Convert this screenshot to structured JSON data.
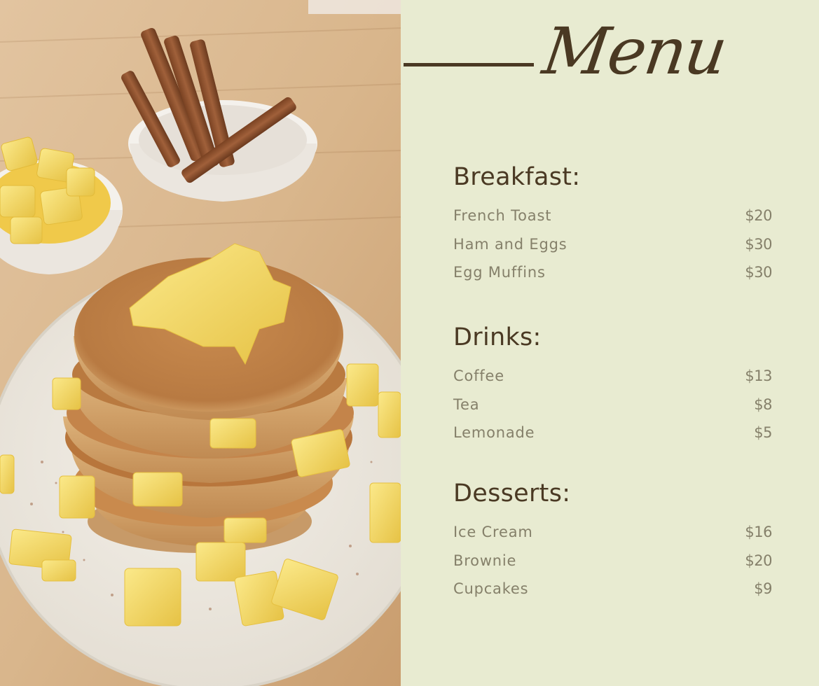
{
  "menu": {
    "title": "Menu",
    "colors": {
      "background": "#e8ebd1",
      "heading": "#4a3923",
      "item_text": "#85806a"
    },
    "photo": {
      "description": "Stack of pancakes topped with diced apples and cinnamon on a white plate, bowl of apple chunks and cinnamon sticks in background"
    },
    "sections": [
      {
        "title": "Breakfast:",
        "items": [
          {
            "name": "French Toast",
            "price": "$20"
          },
          {
            "name": "Ham and Eggs",
            "price": "$30"
          },
          {
            "name": "Egg Muffins",
            "price": "$30"
          }
        ]
      },
      {
        "title": "Drinks:",
        "items": [
          {
            "name": "Coffee",
            "price": "$13"
          },
          {
            "name": "Tea",
            "price": "$8"
          },
          {
            "name": "Lemonade",
            "price": "$5"
          }
        ]
      },
      {
        "title": "Desserts:",
        "items": [
          {
            "name": "Ice Cream",
            "price": "$16"
          },
          {
            "name": "Brownie",
            "price": "$20"
          },
          {
            "name": "Cupcakes",
            "price": "$9"
          }
        ]
      }
    ]
  }
}
